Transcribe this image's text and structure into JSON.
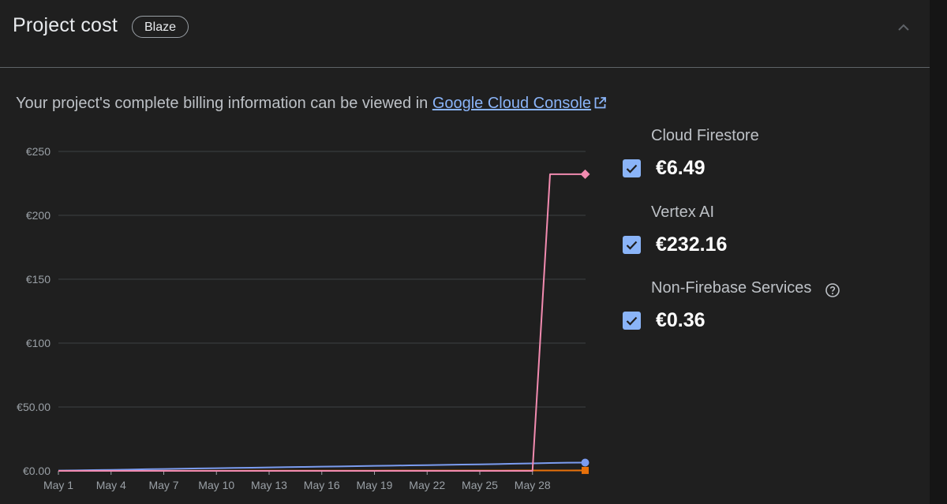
{
  "header": {
    "title": "Project cost",
    "plan_badge": "Blaze"
  },
  "icons": {
    "collapse": "chevron-up-icon",
    "external_link": "open-in-new-icon",
    "help": "help-circle-icon",
    "check": "check-icon"
  },
  "info": {
    "text": "Your project's complete billing information can be viewed in ",
    "link_label": "Google Cloud Console"
  },
  "legend": [
    {
      "label": "Cloud Firestore",
      "value": "€6.49",
      "checked": true,
      "color": "#7b9cf0",
      "marker": "circle"
    },
    {
      "label": "Vertex AI",
      "value": "€232.16",
      "checked": true,
      "color": "#f28bb0",
      "marker": "diamond"
    },
    {
      "label": "Non-Firebase Services",
      "value": "€0.36",
      "checked": true,
      "color": "#e8710a",
      "marker": "square"
    }
  ],
  "colors": {
    "background": "#1f1f1f",
    "accent": "#8ab4f8",
    "gridline": "#3c4043",
    "axis_text": "#9aa0a6"
  },
  "chart_data": {
    "type": "line",
    "ylim": [
      0,
      250
    ],
    "y_ticks": [
      {
        "value": 0,
        "label": "€0.00"
      },
      {
        "value": 50,
        "label": "€50.00"
      },
      {
        "value": 100,
        "label": "€100"
      },
      {
        "value": 150,
        "label": "€150"
      },
      {
        "value": 200,
        "label": "€200"
      },
      {
        "value": 250,
        "label": "€250"
      }
    ],
    "x": [
      1,
      2,
      3,
      4,
      5,
      6,
      7,
      8,
      9,
      10,
      11,
      12,
      13,
      14,
      15,
      16,
      17,
      18,
      19,
      20,
      21,
      22,
      23,
      24,
      25,
      26,
      27,
      28,
      29,
      30,
      31
    ],
    "x_ticks": [
      {
        "value": 1,
        "label": "May 1"
      },
      {
        "value": 4,
        "label": "May 4"
      },
      {
        "value": 7,
        "label": "May 7"
      },
      {
        "value": 10,
        "label": "May 10"
      },
      {
        "value": 13,
        "label": "May 13"
      },
      {
        "value": 16,
        "label": "May 16"
      },
      {
        "value": 19,
        "label": "May 19"
      },
      {
        "value": 22,
        "label": "May 22"
      },
      {
        "value": 25,
        "label": "May 25"
      },
      {
        "value": 28,
        "label": "May 28"
      }
    ],
    "grid": true,
    "series": [
      {
        "name": "Cloud Firestore",
        "color": "#7b9cf0",
        "marker": "circle",
        "values": [
          0.2,
          0.4,
          0.6,
          0.8,
          1.0,
          1.3,
          1.5,
          1.7,
          1.9,
          2.1,
          2.3,
          2.5,
          2.7,
          2.9,
          3.1,
          3.3,
          3.5,
          3.7,
          3.9,
          4.1,
          4.3,
          4.5,
          4.7,
          4.9,
          5.1,
          5.3,
          5.6,
          5.9,
          6.2,
          6.4,
          6.49
        ]
      },
      {
        "name": "Vertex AI",
        "color": "#f28bb0",
        "marker": "diamond",
        "values": [
          0,
          0,
          0,
          0,
          0,
          0,
          0,
          0,
          0,
          0,
          0,
          0,
          0,
          0,
          0,
          0,
          0,
          0,
          0,
          0,
          0,
          0,
          0,
          0,
          0,
          0,
          0,
          0,
          232.16,
          232.16,
          232.16
        ]
      },
      {
        "name": "Non-Firebase Services",
        "color": "#e8710a",
        "marker": "square",
        "values": [
          0.01,
          0.02,
          0.03,
          0.04,
          0.05,
          0.06,
          0.07,
          0.08,
          0.09,
          0.1,
          0.11,
          0.12,
          0.13,
          0.14,
          0.15,
          0.16,
          0.17,
          0.18,
          0.19,
          0.2,
          0.21,
          0.22,
          0.23,
          0.24,
          0.25,
          0.26,
          0.28,
          0.3,
          0.32,
          0.34,
          0.36
        ]
      }
    ]
  }
}
